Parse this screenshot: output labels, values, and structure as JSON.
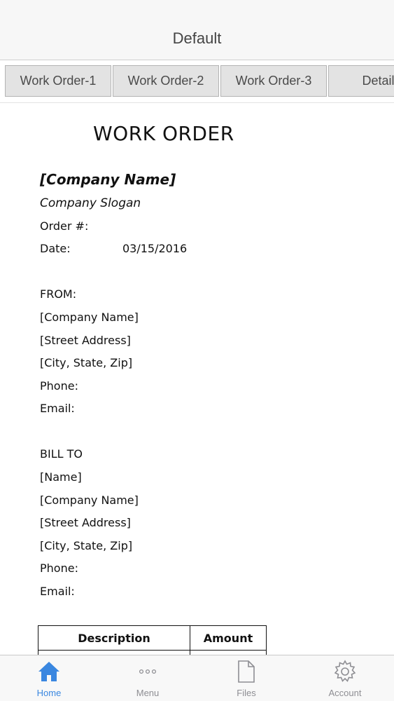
{
  "nav": {
    "title": "Default"
  },
  "sheet_tabs": [
    "Work Order-1",
    "Work Order-2",
    "Work Order-3",
    "Details"
  ],
  "document": {
    "title": "WORK ORDER",
    "company_name": "[Company Name]",
    "slogan": "Company Slogan",
    "order_label": "Order #:",
    "date_label": "Date:",
    "date_value": "03/15/2016",
    "from": {
      "heading": "FROM:",
      "company": "[Company Name]",
      "street": "[Street Address]",
      "city": "[City, State, Zip]",
      "phone": "Phone:",
      "email": "Email:"
    },
    "bill_to": {
      "heading": "BILL TO",
      "name": "[Name]",
      "company": "[Company Name]",
      "street": "[Street Address]",
      "city": "[City, State, Zip]",
      "phone": "Phone:",
      "email": "Email:"
    },
    "table": {
      "headers": [
        "Description",
        "Amount"
      ]
    }
  },
  "tab_bar": {
    "active_color": "#3a87e0",
    "inactive_color": "#8e8e93",
    "items": [
      {
        "label": "Home",
        "icon": "home-icon",
        "active": true
      },
      {
        "label": "Menu",
        "icon": "more-icon",
        "active": false
      },
      {
        "label": "Files",
        "icon": "file-icon",
        "active": false
      },
      {
        "label": "Account",
        "icon": "gear-icon",
        "active": false
      }
    ]
  }
}
